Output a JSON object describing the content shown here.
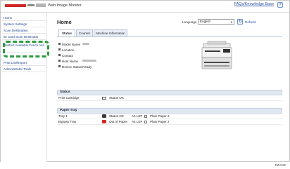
{
  "header": {
    "app_title": "Web Image Monitor",
    "faq_link": "FAQs/Knowledge Base",
    "help_label": "?"
  },
  "sidebar": {
    "items": [
      {
        "label": "Home"
      },
      {
        "label": "System Settings"
      },
      {
        "label": "Scan Destination"
      },
      {
        "label": "ID Card Scan Destinatio"
      },
      {
        "label": "Restrict Available Functi ons"
      },
      {
        "label": "Print List/Report"
      },
      {
        "label": "Administrator Tools"
      }
    ]
  },
  "main": {
    "title": "Home",
    "language": {
      "label": "Language",
      "value": "English"
    },
    "refresh_label": "Refresh",
    "tabs": [
      {
        "label": "Status"
      },
      {
        "label": "Counter"
      },
      {
        "label": "Machine Information"
      }
    ],
    "info": [
      {
        "label": "Model Name",
        "value": ""
      },
      {
        "label": "Location",
        "value": ""
      },
      {
        "label": "Contact",
        "value": ""
      },
      {
        "label": "Host Name",
        "value": ""
      },
      {
        "label": "Device Status",
        "value": "Ready"
      }
    ]
  },
  "status_section": {
    "title": "Status",
    "rows": [
      {
        "name": "Print Cartridge",
        "status": "Status OK"
      }
    ]
  },
  "paper_section": {
    "title": "Paper Tray",
    "rows": [
      {
        "name": "Tray 1",
        "status": "Status OK",
        "size": "A4 LEF",
        "type": "Plain Paper 2"
      },
      {
        "name": "Bypass Tray",
        "status": "Out of Paper",
        "size": "A4 LEF",
        "type": "Plain Paper 2"
      }
    ]
  },
  "footer_code": "DZV492",
  "colors": {
    "highlight": "#2b9a3e",
    "link": "#2a55a8",
    "error": "#d42828"
  }
}
